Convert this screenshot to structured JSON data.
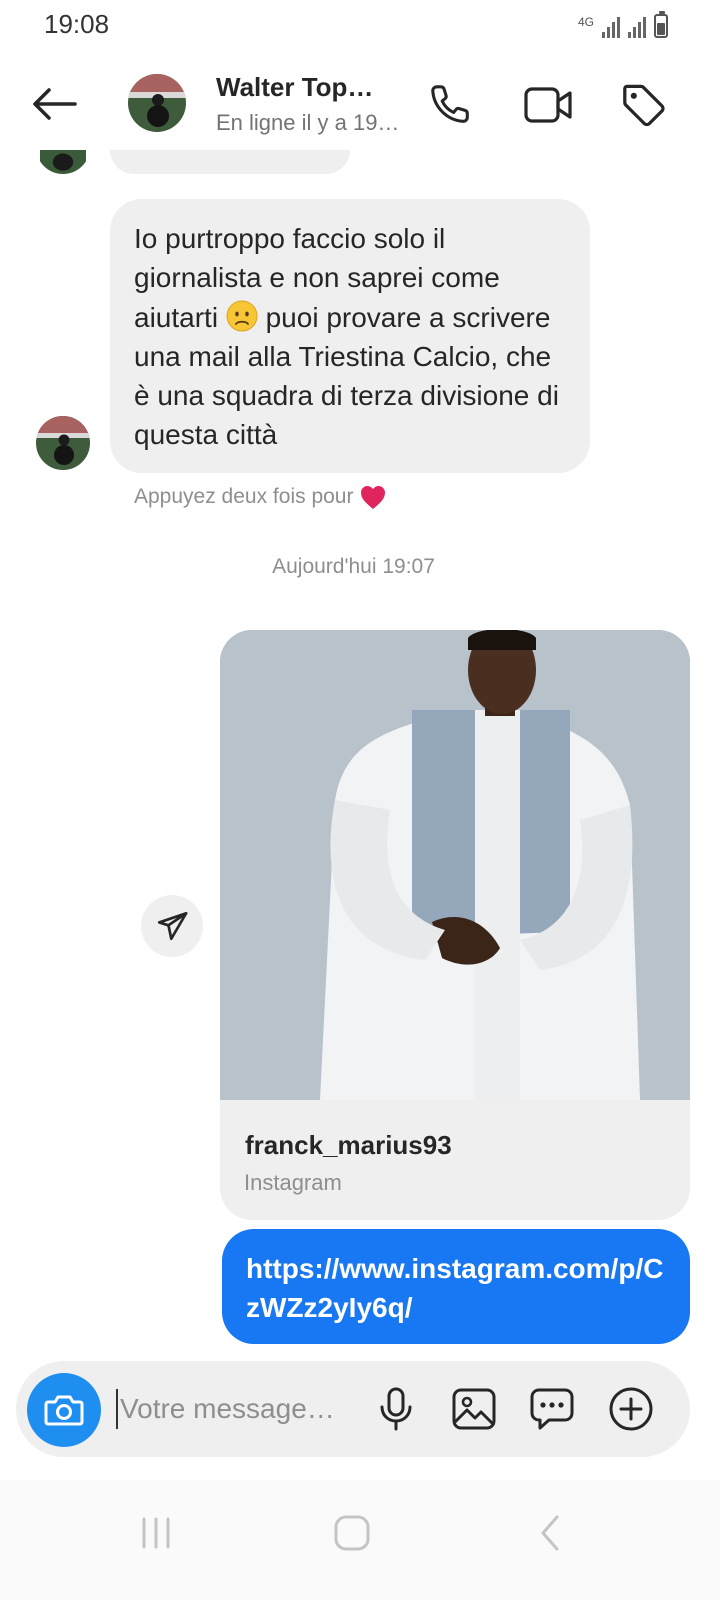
{
  "status_bar": {
    "time": "19:08",
    "network": "4G"
  },
  "header": {
    "contact_name": "Walter Top…",
    "contact_status": "En ligne il y a 19…",
    "icons": [
      "back-arrow-icon",
      "phone-icon",
      "video-camera-icon",
      "tag-icon"
    ]
  },
  "messages": {
    "incoming_text": "Io purtroppo faccio solo il giornalista e non saprei come aiutarti",
    "incoming_emoji": "worried-face",
    "incoming_text_after": " puoi provare a scrivere una mail alla Triestina Calcio, che è una squadra di terza divisione di questa città",
    "double_tap_hint": "Appuyez deux fois pour",
    "heart_emoji": "❤️",
    "date_separator": "Aujourd'hui 19:07",
    "shared_post": {
      "username": "franck_marius93",
      "source": "Instagram"
    },
    "outgoing_link": "https://www.instagram.com/p/CzWZz2yIy6q/"
  },
  "composer": {
    "placeholder": "Votre message…",
    "icons": [
      "camera-icon",
      "microphone-icon",
      "gallery-icon",
      "sticker-icon",
      "plus-icon"
    ]
  },
  "colors": {
    "accent_blue": "#1877f2",
    "camera_blue": "#1f8ef1",
    "bubble_gray": "#efefef",
    "secondary_text": "#8e8e8e",
    "heart_red": "#e0245e"
  }
}
